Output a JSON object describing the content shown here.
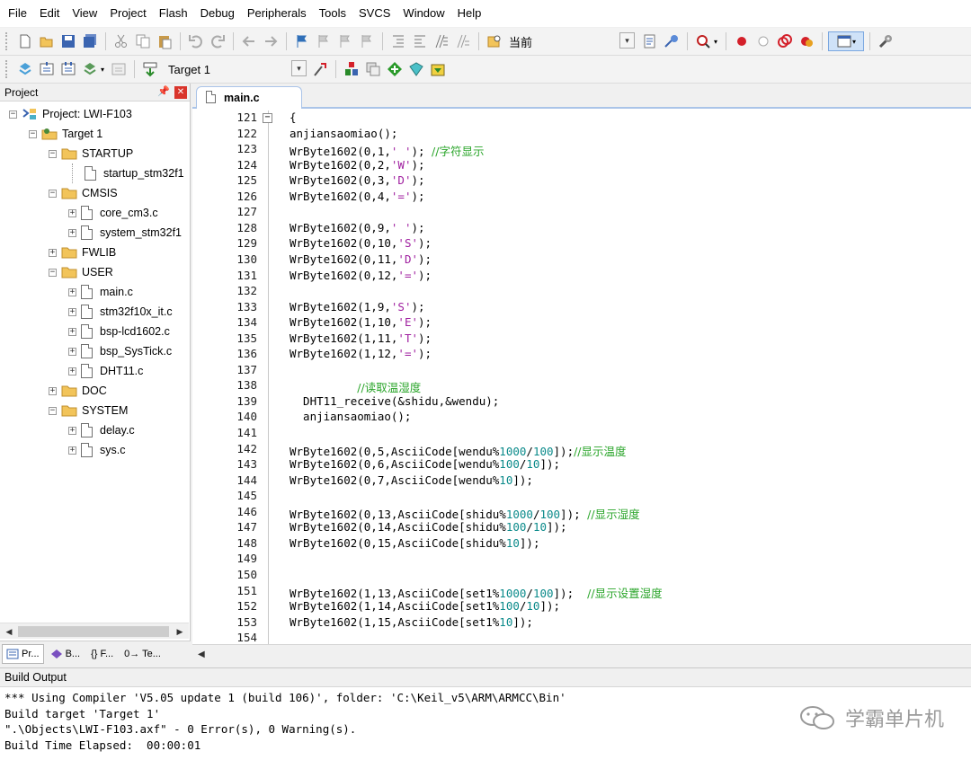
{
  "menu": [
    "File",
    "Edit",
    "View",
    "Project",
    "Flash",
    "Debug",
    "Peripherals",
    "Tools",
    "SVCS",
    "Window",
    "Help"
  ],
  "toolbar1": {
    "find_text": "当前"
  },
  "toolbar2": {
    "target": "Target 1"
  },
  "project_panel": {
    "title": "Project",
    "tree": [
      {
        "label": "Project: LWI-F103",
        "level": 0,
        "kind": "project",
        "exp": "−"
      },
      {
        "label": "Target 1",
        "level": 1,
        "kind": "target",
        "exp": "−"
      },
      {
        "label": "STARTUP",
        "level": 2,
        "kind": "folder",
        "exp": "−"
      },
      {
        "label": "startup_stm32f1",
        "level": 3,
        "kind": "file",
        "exp": ""
      },
      {
        "label": "CMSIS",
        "level": 2,
        "kind": "folder",
        "exp": "−"
      },
      {
        "label": "core_cm3.c",
        "level": 3,
        "kind": "file",
        "exp": "+"
      },
      {
        "label": "system_stm32f1",
        "level": 3,
        "kind": "file",
        "exp": "+"
      },
      {
        "label": "FWLIB",
        "level": 2,
        "kind": "folder",
        "exp": "+"
      },
      {
        "label": "USER",
        "level": 2,
        "kind": "folder",
        "exp": "−"
      },
      {
        "label": "main.c",
        "level": 3,
        "kind": "file",
        "exp": "+"
      },
      {
        "label": "stm32f10x_it.c",
        "level": 3,
        "kind": "file",
        "exp": "+"
      },
      {
        "label": "bsp-lcd1602.c",
        "level": 3,
        "kind": "file",
        "exp": "+"
      },
      {
        "label": "bsp_SysTick.c",
        "level": 3,
        "kind": "file",
        "exp": "+"
      },
      {
        "label": "DHT11.c",
        "level": 3,
        "kind": "file",
        "exp": "+"
      },
      {
        "label": "DOC",
        "level": 2,
        "kind": "folder",
        "exp": "+"
      },
      {
        "label": "SYSTEM",
        "level": 2,
        "kind": "folder",
        "exp": "−"
      },
      {
        "label": "delay.c",
        "level": 3,
        "kind": "file",
        "exp": "+"
      },
      {
        "label": "sys.c",
        "level": 3,
        "kind": "file",
        "exp": "+"
      }
    ],
    "tabs": [
      "Pr...",
      "B...",
      "{} F...",
      "0→ Te..."
    ]
  },
  "editor": {
    "tab": "main.c",
    "lines": [
      {
        "n": "121",
        "t": "{"
      },
      {
        "n": "122",
        "t": "anjiansaomiao();"
      },
      {
        "n": "123",
        "t": "WrByte1602(0,1,' '); //字符显示"
      },
      {
        "n": "124",
        "t": "WrByte1602(0,2,'W');"
      },
      {
        "n": "125",
        "t": "WrByte1602(0,3,'D');"
      },
      {
        "n": "126",
        "t": "WrByte1602(0,4,'=');"
      },
      {
        "n": "127",
        "t": ""
      },
      {
        "n": "128",
        "t": "WrByte1602(0,9,' ');"
      },
      {
        "n": "129",
        "t": "WrByte1602(0,10,'S');"
      },
      {
        "n": "130",
        "t": "WrByte1602(0,11,'D');"
      },
      {
        "n": "131",
        "t": "WrByte1602(0,12,'=');"
      },
      {
        "n": "132",
        "t": ""
      },
      {
        "n": "133",
        "t": "WrByte1602(1,9,'S');"
      },
      {
        "n": "134",
        "t": "WrByte1602(1,10,'E');"
      },
      {
        "n": "135",
        "t": "WrByte1602(1,11,'T');"
      },
      {
        "n": "136",
        "t": "WrByte1602(1,12,'=');"
      },
      {
        "n": "137",
        "t": ""
      },
      {
        "n": "138",
        "t": "          //读取温湿度"
      },
      {
        "n": "139",
        "t": "  DHT11_receive(&shidu,&wendu);"
      },
      {
        "n": "140",
        "t": "  anjiansaomiao();"
      },
      {
        "n": "141",
        "t": ""
      },
      {
        "n": "142",
        "t": "WrByte1602(0,5,AsciiCode[wendu%1000/100]);//显示温度"
      },
      {
        "n": "143",
        "t": "WrByte1602(0,6,AsciiCode[wendu%100/10]);"
      },
      {
        "n": "144",
        "t": "WrByte1602(0,7,AsciiCode[wendu%10]);"
      },
      {
        "n": "145",
        "t": ""
      },
      {
        "n": "146",
        "t": "WrByte1602(0,13,AsciiCode[shidu%1000/100]); //显示湿度"
      },
      {
        "n": "147",
        "t": "WrByte1602(0,14,AsciiCode[shidu%100/10]);"
      },
      {
        "n": "148",
        "t": "WrByte1602(0,15,AsciiCode[shidu%10]);"
      },
      {
        "n": "149",
        "t": ""
      },
      {
        "n": "150",
        "t": ""
      },
      {
        "n": "151",
        "t": "WrByte1602(1,13,AsciiCode[set1%1000/100]);  //显示设置湿度"
      },
      {
        "n": "152",
        "t": "WrByte1602(1,14,AsciiCode[set1%100/10]);"
      },
      {
        "n": "153",
        "t": "WrByte1602(1,15,AsciiCode[set1%10]);"
      },
      {
        "n": "154",
        "t": ""
      }
    ]
  },
  "build_output": {
    "title": "Build Output",
    "lines": [
      "*** Using Compiler 'V5.05 update 1 (build 106)', folder: 'C:\\Keil_v5\\ARM\\ARMCC\\Bin'",
      "Build target 'Target 1'",
      "\".\\Objects\\LWI-F103.axf\" - 0 Error(s), 0 Warning(s).",
      "Build Time Elapsed:  00:00:01"
    ],
    "watermark": "学霸单片机"
  }
}
